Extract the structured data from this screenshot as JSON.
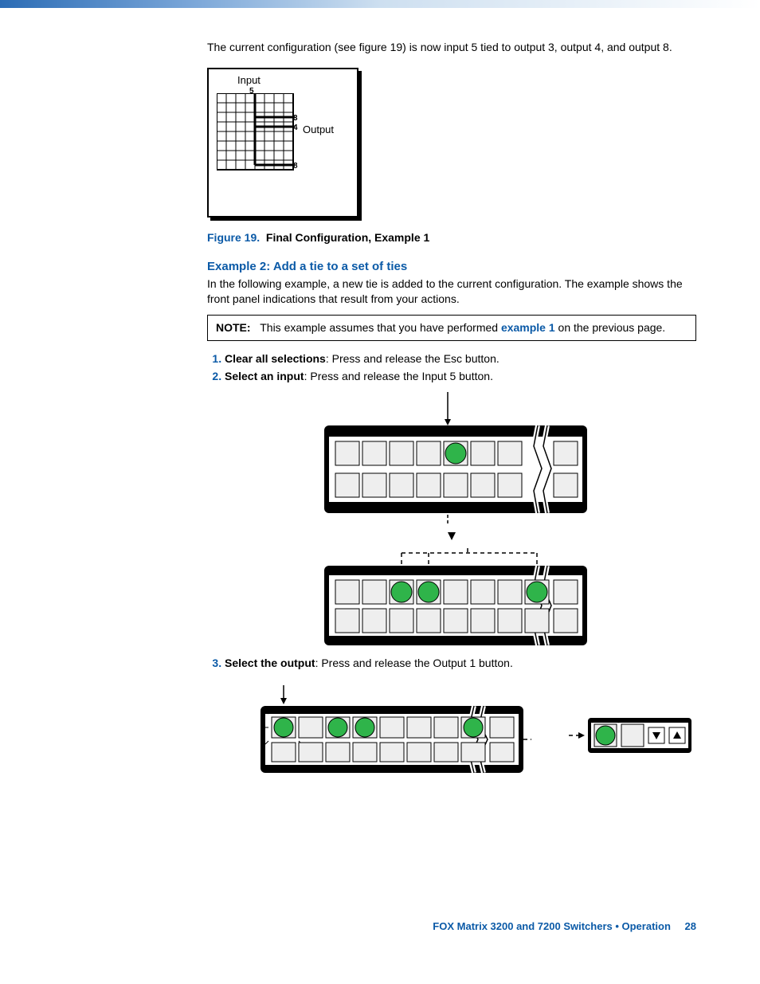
{
  "intro_text": "The current configuration (see figure 19) is now input 5 tied to output 3, output 4, and output 8.",
  "grid": {
    "input_label": "Input",
    "output_label": "Output",
    "input_num": "5",
    "out3": "3",
    "out4": "4",
    "out8": "8"
  },
  "figure19": {
    "ref": "Figure 19.",
    "caption": "Final Configuration, Example 1"
  },
  "example2": {
    "title": "Example 2: Add a tie to a set of ties",
    "intro": "In the following example, a new tie is added to the current configuration. The example shows the front panel indications that result from your actions."
  },
  "note": {
    "label": "NOTE:",
    "before_link": "This example assumes that you have performed ",
    "link_text": "example 1",
    "after_link": " on the previous page."
  },
  "steps": {
    "s1_bold": "Clear all selections",
    "s1_rest": ": Press and release the Esc button.",
    "s2_bold": "Select an input",
    "s2_rest": ": Press and release the Input 5 button.",
    "s3_bold": "Select the output",
    "s3_rest": ": Press and release the Output 1 button."
  },
  "footer": {
    "text": "FOX Matrix 3200 and 7200 Switchers • Operation",
    "page": "28"
  }
}
